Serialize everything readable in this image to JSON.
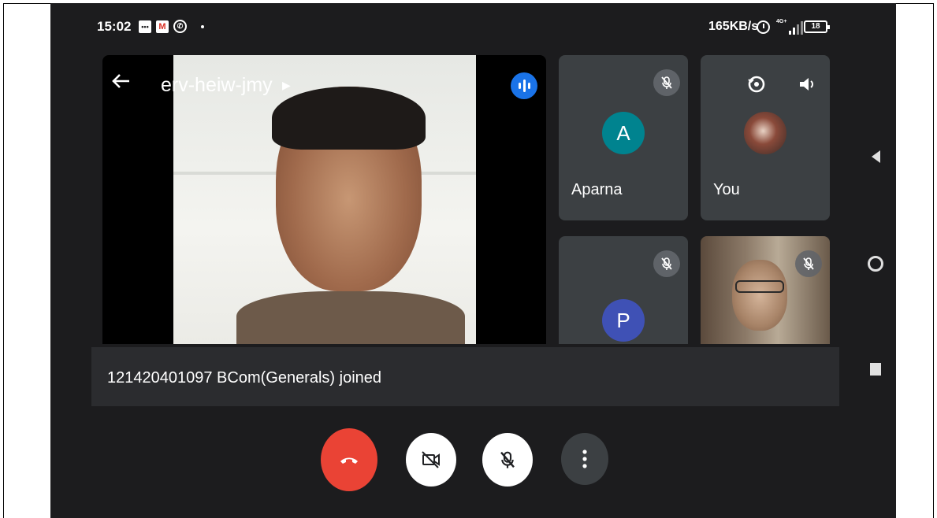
{
  "status_bar": {
    "time": "15:02",
    "net_speed": "165KB/s",
    "network_type": "4G+",
    "battery": "18",
    "icons": [
      "message-icon",
      "gmail-icon",
      "whatsapp-icon",
      "alarm-icon",
      "signal-icon",
      "battery-icon"
    ]
  },
  "meeting": {
    "room_code": "erv-heiw-jmy",
    "speaking_indicator": "audio-level-icon"
  },
  "participants": [
    {
      "name": "Aparna",
      "initial": "A",
      "avatar_color": "#00838f",
      "muted": true
    },
    {
      "name": "You",
      "muted": false
    },
    {
      "name": "",
      "initial": "P",
      "avatar_color": "#3f51b5",
      "muted": true
    },
    {
      "name": "",
      "muted": true
    }
  ],
  "notification": {
    "text": "121420401097 BCom(Generals) joined"
  },
  "controls": {
    "end_call_color": "#ea4335",
    "camera_state": "off",
    "mic_state": "muted"
  },
  "colors": {
    "background": "#1c1c1e",
    "tile": "#3c4043",
    "accent_blue": "#1a73e8"
  }
}
